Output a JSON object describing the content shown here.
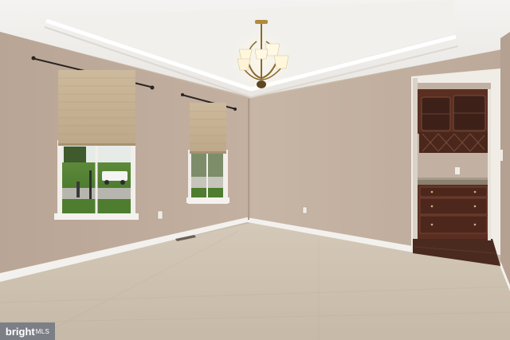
{
  "scene": {
    "description_colors": {
      "wall": "#c1ad9e",
      "ceiling": "#f1efec",
      "carpet": "#cbbfae",
      "trim": "#f4f2ee",
      "cabinet": "#5a2f22",
      "shade": "#c9b597"
    }
  },
  "watermark": {
    "brand": "bright",
    "suffix": "MLS"
  }
}
